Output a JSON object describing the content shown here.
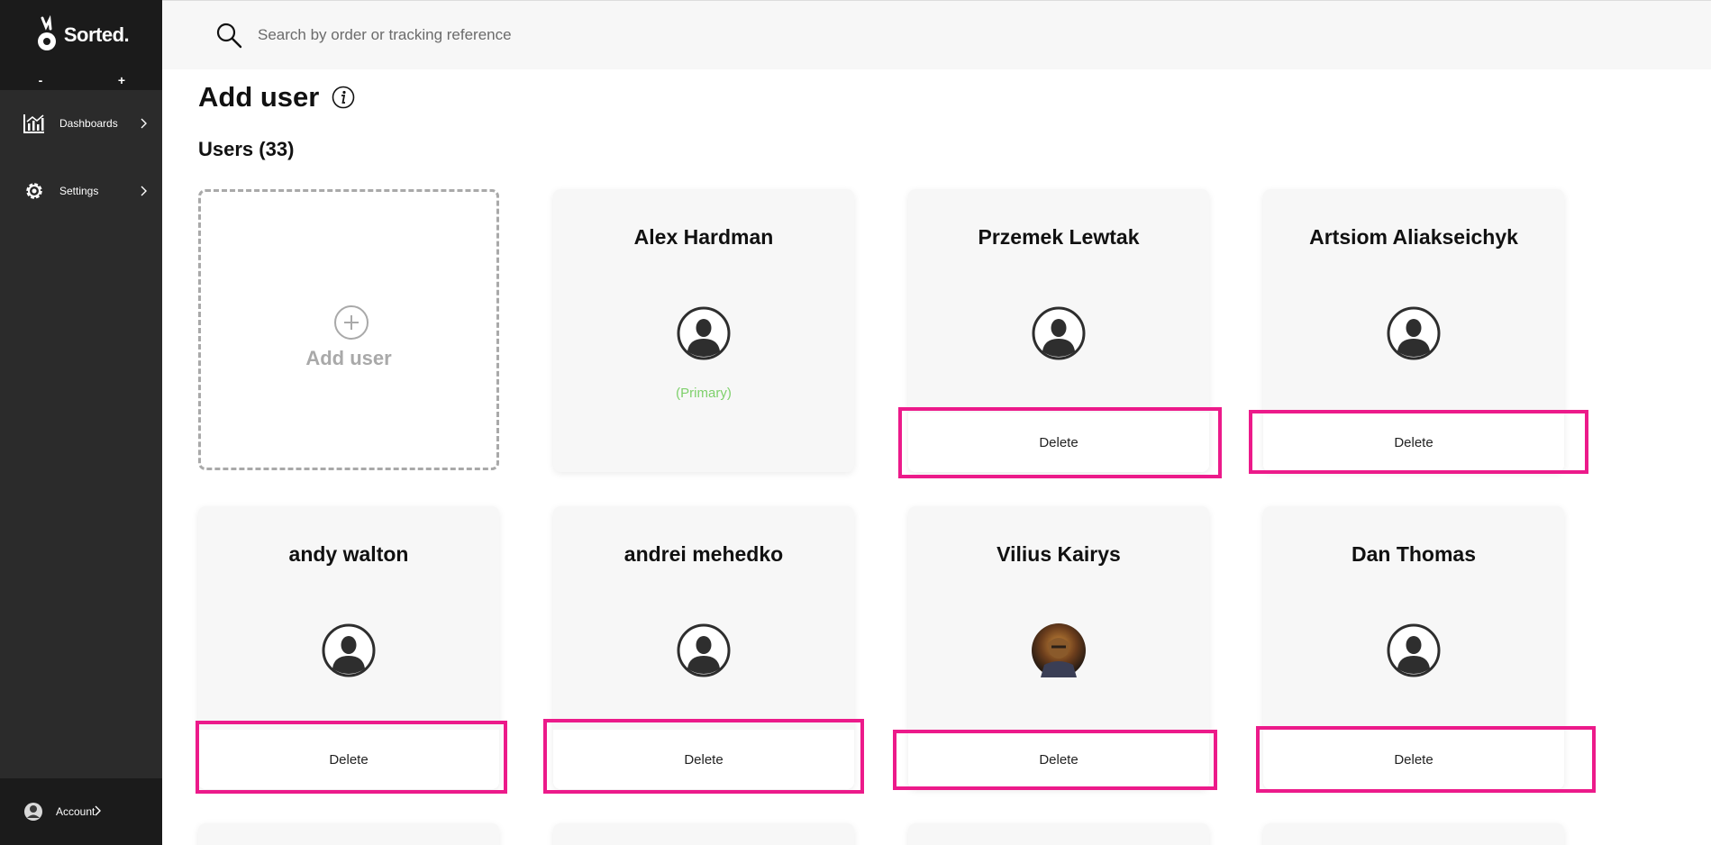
{
  "brand": {
    "name": "Sorted."
  },
  "zoom": {
    "minus": "-",
    "plus": "+"
  },
  "nav": {
    "dashboards": "Dashboards",
    "settings": "Settings",
    "account": "Account"
  },
  "search": {
    "placeholder": "Search by order or tracking reference"
  },
  "page": {
    "title": "Add user",
    "users_count": "Users (33)"
  },
  "add_card": {
    "label": "Add user"
  },
  "users": [
    {
      "name": "Alex Hardman",
      "primary_label": "(Primary)"
    },
    {
      "name": "Przemek Lewtak",
      "delete_label": "Delete"
    },
    {
      "name": "Artsiom Aliakseichyk",
      "delete_label": "Delete"
    },
    {
      "name": "andy walton",
      "delete_label": "Delete"
    },
    {
      "name": "andrei mehedko",
      "delete_label": "Delete"
    },
    {
      "name": "Vilius Kairys",
      "delete_label": "Delete"
    },
    {
      "name": "Dan Thomas",
      "delete_label": "Delete"
    }
  ],
  "colors": {
    "sidebar": "#2b2b2b",
    "highlight": "#ec1a8a",
    "primary_text": "#7ed06b",
    "card_bg": "#f7f7f7"
  }
}
